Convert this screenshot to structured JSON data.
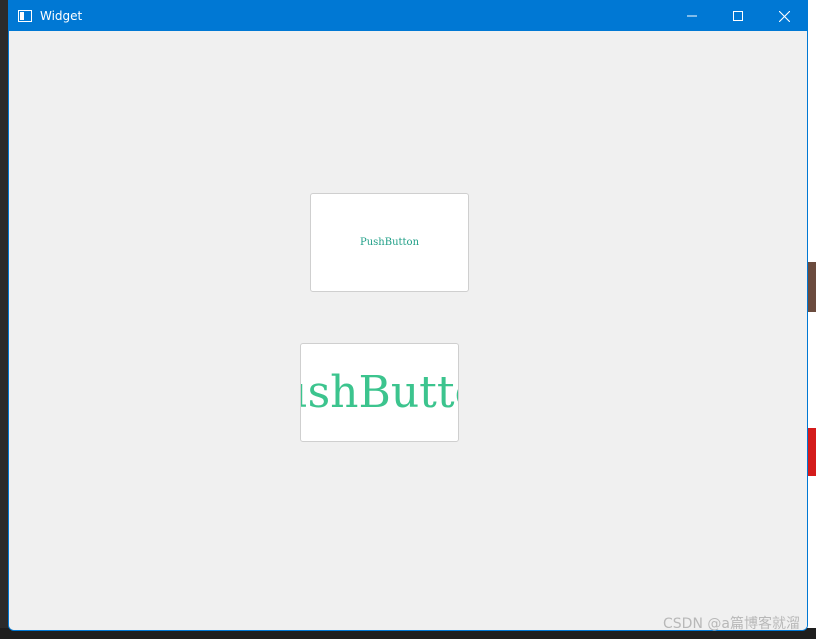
{
  "window": {
    "title": "Widget"
  },
  "titlebar": {
    "controls": {
      "minimize_icon": "minimize-icon",
      "maximize_icon": "maximize-icon",
      "close_icon": "close-icon"
    }
  },
  "buttons": [
    {
      "label": "PushButton"
    },
    {
      "label": "PushButton"
    }
  ],
  "watermark": {
    "text": "CSDN @a篇博客就溜"
  },
  "colors": {
    "titlebar": "#0078d4",
    "client": "#f0f0f0",
    "button_bg": "#ffffff",
    "button1_text": "#1e9e86",
    "button2_text": "#3cc48e"
  }
}
